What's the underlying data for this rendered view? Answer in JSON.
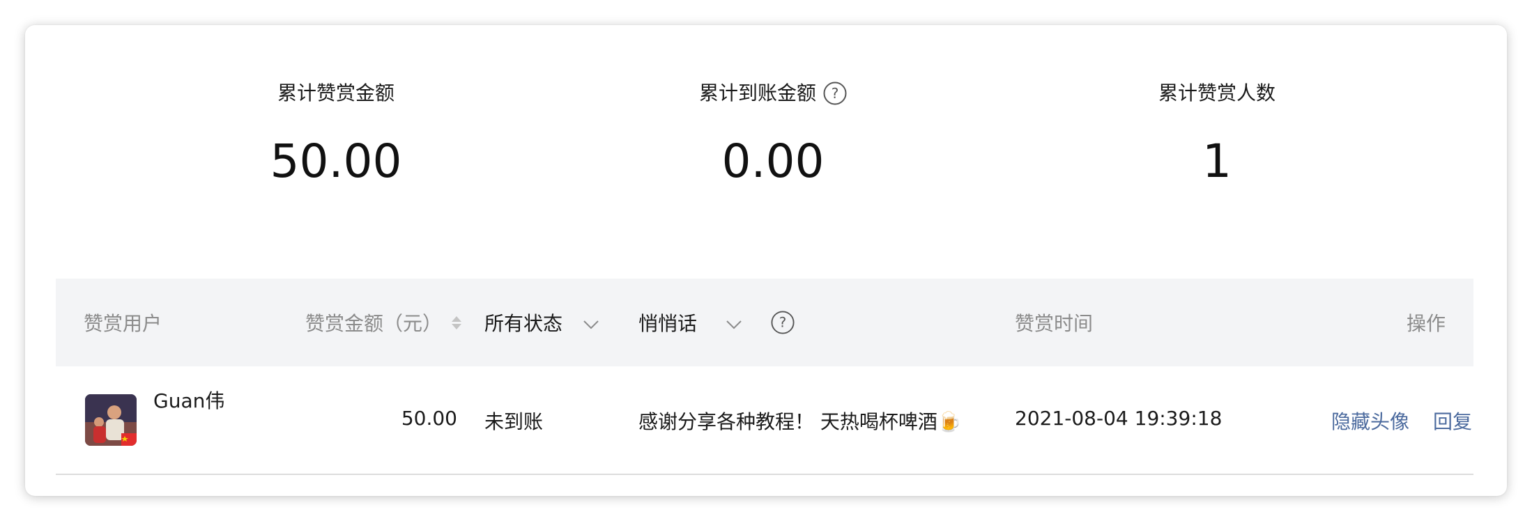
{
  "stats": [
    {
      "label": "累计赞赏金额",
      "value": "50.00"
    },
    {
      "label": "累计到账金额",
      "value": "0.00",
      "help_icon": "question-circle-icon"
    },
    {
      "label": "累计赞赏人数",
      "value": "1"
    }
  ],
  "table": {
    "headers": {
      "user": "赞赏用户",
      "amount": "赞赏金额（元）",
      "status": "所有状态",
      "whisper": "悄悄话",
      "time": "赞赏时间",
      "action": "操作"
    },
    "rows": [
      {
        "user_name": "Guan伟",
        "amount": "50.00",
        "status": "未到账",
        "message": "感谢分享各种教程！ 天热喝杯啤酒🍺",
        "time": "2021-08-04 19:39:18",
        "actions": {
          "hide_avatar": "隐藏头像",
          "reply": "回复"
        }
      }
    ]
  },
  "colors": {
    "link": "#4b6a9e",
    "header_bg": "#f3f4f6",
    "muted_text": "#8b8b8b"
  }
}
